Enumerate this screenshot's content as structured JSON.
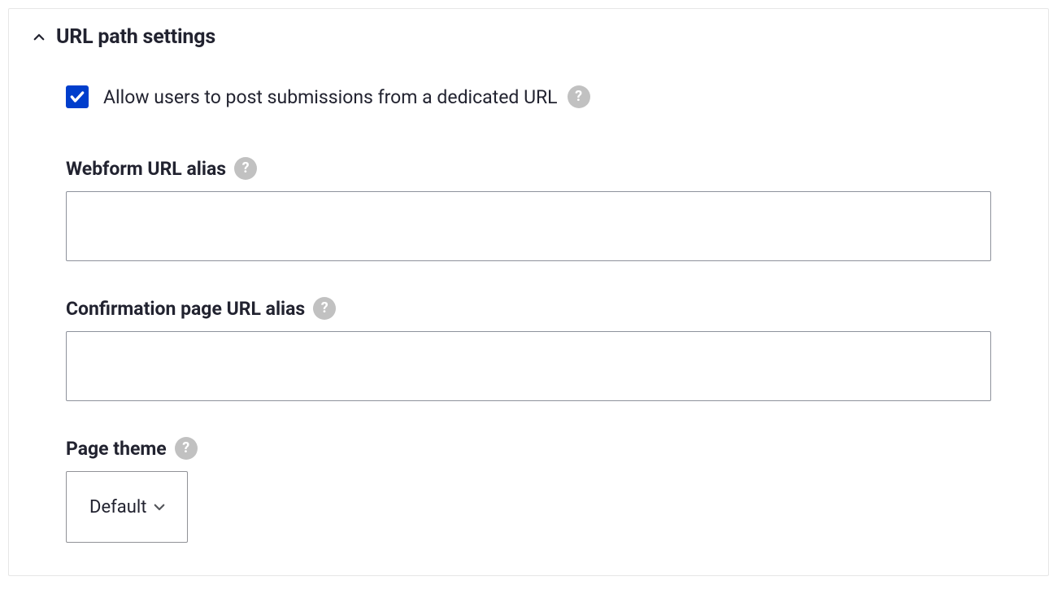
{
  "section": {
    "title": "URL path settings"
  },
  "checkbox": {
    "label": "Allow users to post submissions from a dedicated URL",
    "checked": true
  },
  "fields": {
    "webform_alias": {
      "label": "Webform URL alias",
      "value": ""
    },
    "confirmation_alias": {
      "label": "Confirmation page URL alias",
      "value": ""
    },
    "page_theme": {
      "label": "Page theme",
      "selected": "Default"
    }
  },
  "help_glyph": "?"
}
